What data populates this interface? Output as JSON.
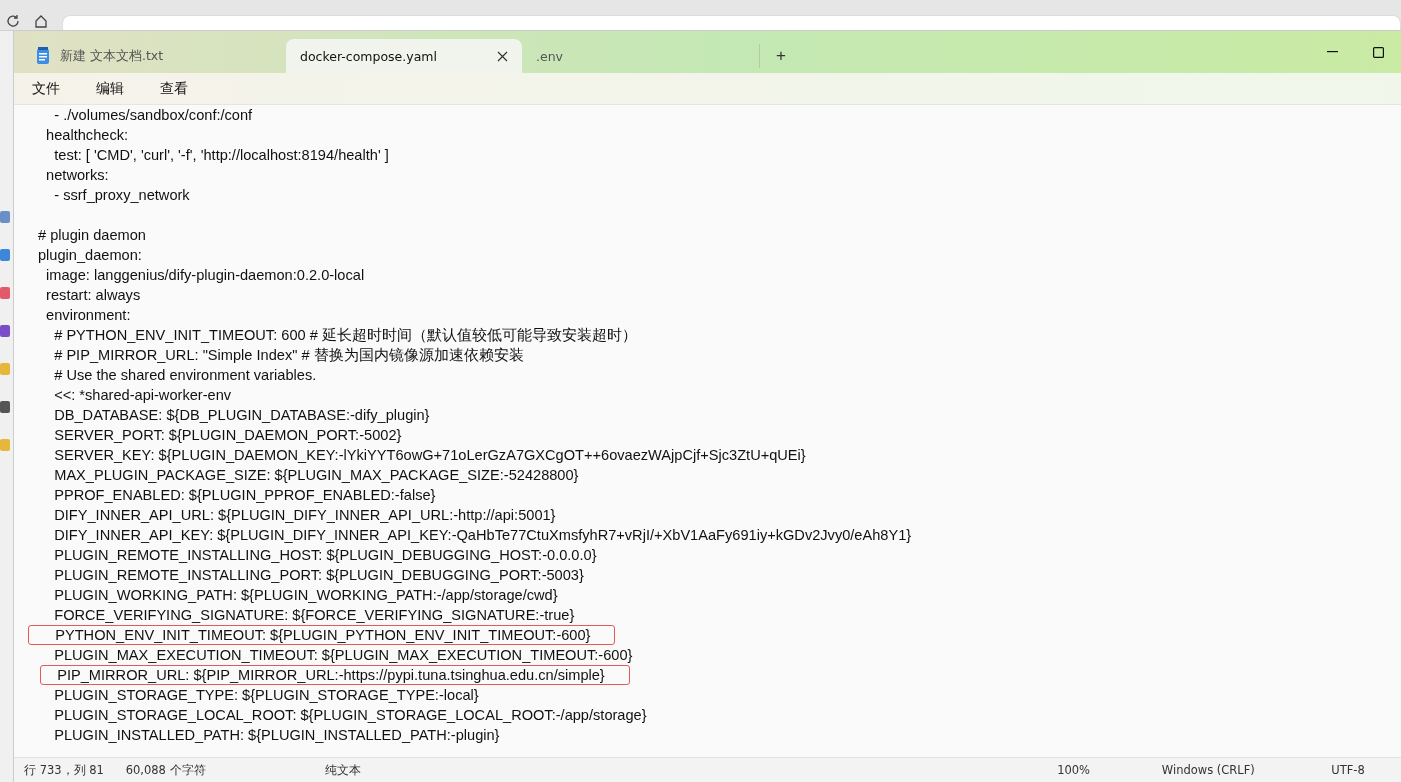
{
  "tabs": [
    {
      "label": "新建 文本文档.txt",
      "selected": false,
      "icon": true,
      "closable": false
    },
    {
      "label": "docker-compose.yaml",
      "selected": true,
      "icon": false,
      "closable": true
    },
    {
      "label": ".env",
      "selected": false,
      "icon": false,
      "closable": false
    }
  ],
  "new_tab": "+",
  "menu": [
    "文件",
    "编辑",
    "查看"
  ],
  "lines": [
    {
      "kind": "code",
      "text": "    - ./volumes/sandbox/conf:/conf"
    },
    {
      "kind": "code",
      "text": "  healthcheck:"
    },
    {
      "kind": "code",
      "text": "    test: [ 'CMD', 'curl', '-f', 'http://localhost:8194/health' ]"
    },
    {
      "kind": "code",
      "text": "  networks:"
    },
    {
      "kind": "code",
      "text": "    - ssrf_proxy_network"
    },
    {
      "kind": "blank"
    },
    {
      "kind": "code",
      "text": "# plugin daemon"
    },
    {
      "kind": "code",
      "text": "plugin_daemon:"
    },
    {
      "kind": "code",
      "text": "  image: langgenius/dify-plugin-daemon:0.2.0-local"
    },
    {
      "kind": "code",
      "text": "  restart: always"
    },
    {
      "kind": "code",
      "text": "  environment:"
    },
    {
      "kind": "code",
      "text": "    # PYTHON_ENV_INIT_TIMEOUT: 600 # 延长超时时间（默认值较低可能导致安装超时）"
    },
    {
      "kind": "code",
      "text": "    # PIP_MIRROR_URL: \"Simple Index\" # 替换为国内镜像源加速依赖安装"
    },
    {
      "kind": "code",
      "text": "    # Use the shared environment variables."
    },
    {
      "kind": "code",
      "text": "    <<: *shared-api-worker-env"
    },
    {
      "kind": "code",
      "text": "    DB_DATABASE: ${DB_PLUGIN_DATABASE:-dify_plugin}"
    },
    {
      "kind": "code",
      "text": "    SERVER_PORT: ${PLUGIN_DAEMON_PORT:-5002}"
    },
    {
      "kind": "code",
      "text": "    SERVER_KEY: ${PLUGIN_DAEMON_KEY:-lYkiYYT6owG+71oLerGzA7GXCgOT++6ovaezWAjpCjf+Sjc3ZtU+qUEi}"
    },
    {
      "kind": "code",
      "text": "    MAX_PLUGIN_PACKAGE_SIZE: ${PLUGIN_MAX_PACKAGE_SIZE:-52428800}"
    },
    {
      "kind": "code",
      "text": "    PPROF_ENABLED: ${PLUGIN_PPROF_ENABLED:-false}"
    },
    {
      "kind": "code",
      "text": "    DIFY_INNER_API_URL: ${PLUGIN_DIFY_INNER_API_URL:-http://api:5001}"
    },
    {
      "kind": "code",
      "text": "    DIFY_INNER_API_KEY: ${PLUGIN_DIFY_INNER_API_KEY:-QaHbTe77CtuXmsfyhR7+vRjI/+XbV1AaFy691iy+kGDv2Jvy0/eAh8Y1}"
    },
    {
      "kind": "code",
      "text": "    PLUGIN_REMOTE_INSTALLING_HOST: ${PLUGIN_DEBUGGING_HOST:-0.0.0.0}"
    },
    {
      "kind": "code",
      "text": "    PLUGIN_REMOTE_INSTALLING_PORT: ${PLUGIN_DEBUGGING_PORT:-5003}"
    },
    {
      "kind": "code",
      "text": "    PLUGIN_WORKING_PATH: ${PLUGIN_WORKING_PATH:-/app/storage/cwd}"
    },
    {
      "kind": "code",
      "text": "    FORCE_VERIFYING_SIGNATURE: ${FORCE_VERIFYING_SIGNATURE:-true}"
    },
    {
      "kind": "boxed",
      "text": "    PYTHON_ENV_INIT_TIMEOUT: ${PLUGIN_PYTHON_ENV_INIT_TIMEOUT:-600}"
    },
    {
      "kind": "code",
      "text": "    PLUGIN_MAX_EXECUTION_TIMEOUT: ${PLUGIN_MAX_EXECUTION_TIMEOUT:-600}"
    },
    {
      "kind": "boxed",
      "text": "    PIP_MIRROR_URL: ${PIP_MIRROR_URL:-https://pypi.tuna.tsinghua.edu.cn/simple}"
    },
    {
      "kind": "code",
      "text": "    PLUGIN_STORAGE_TYPE: ${PLUGIN_STORAGE_TYPE:-local}"
    },
    {
      "kind": "code",
      "text": "    PLUGIN_STORAGE_LOCAL_ROOT: ${PLUGIN_STORAGE_LOCAL_ROOT:-/app/storage}"
    },
    {
      "kind": "code",
      "text": "    PLUGIN_INSTALLED_PATH: ${PLUGIN_INSTALLED_PATH:-plugin}"
    }
  ],
  "status_bar": {
    "position": "行 733，列 81",
    "characters": "60,088 个字符",
    "format": "纯文本",
    "zoom": "100%",
    "line_ending": "Windows (CRLF)",
    "encoding": "UTF-8"
  }
}
